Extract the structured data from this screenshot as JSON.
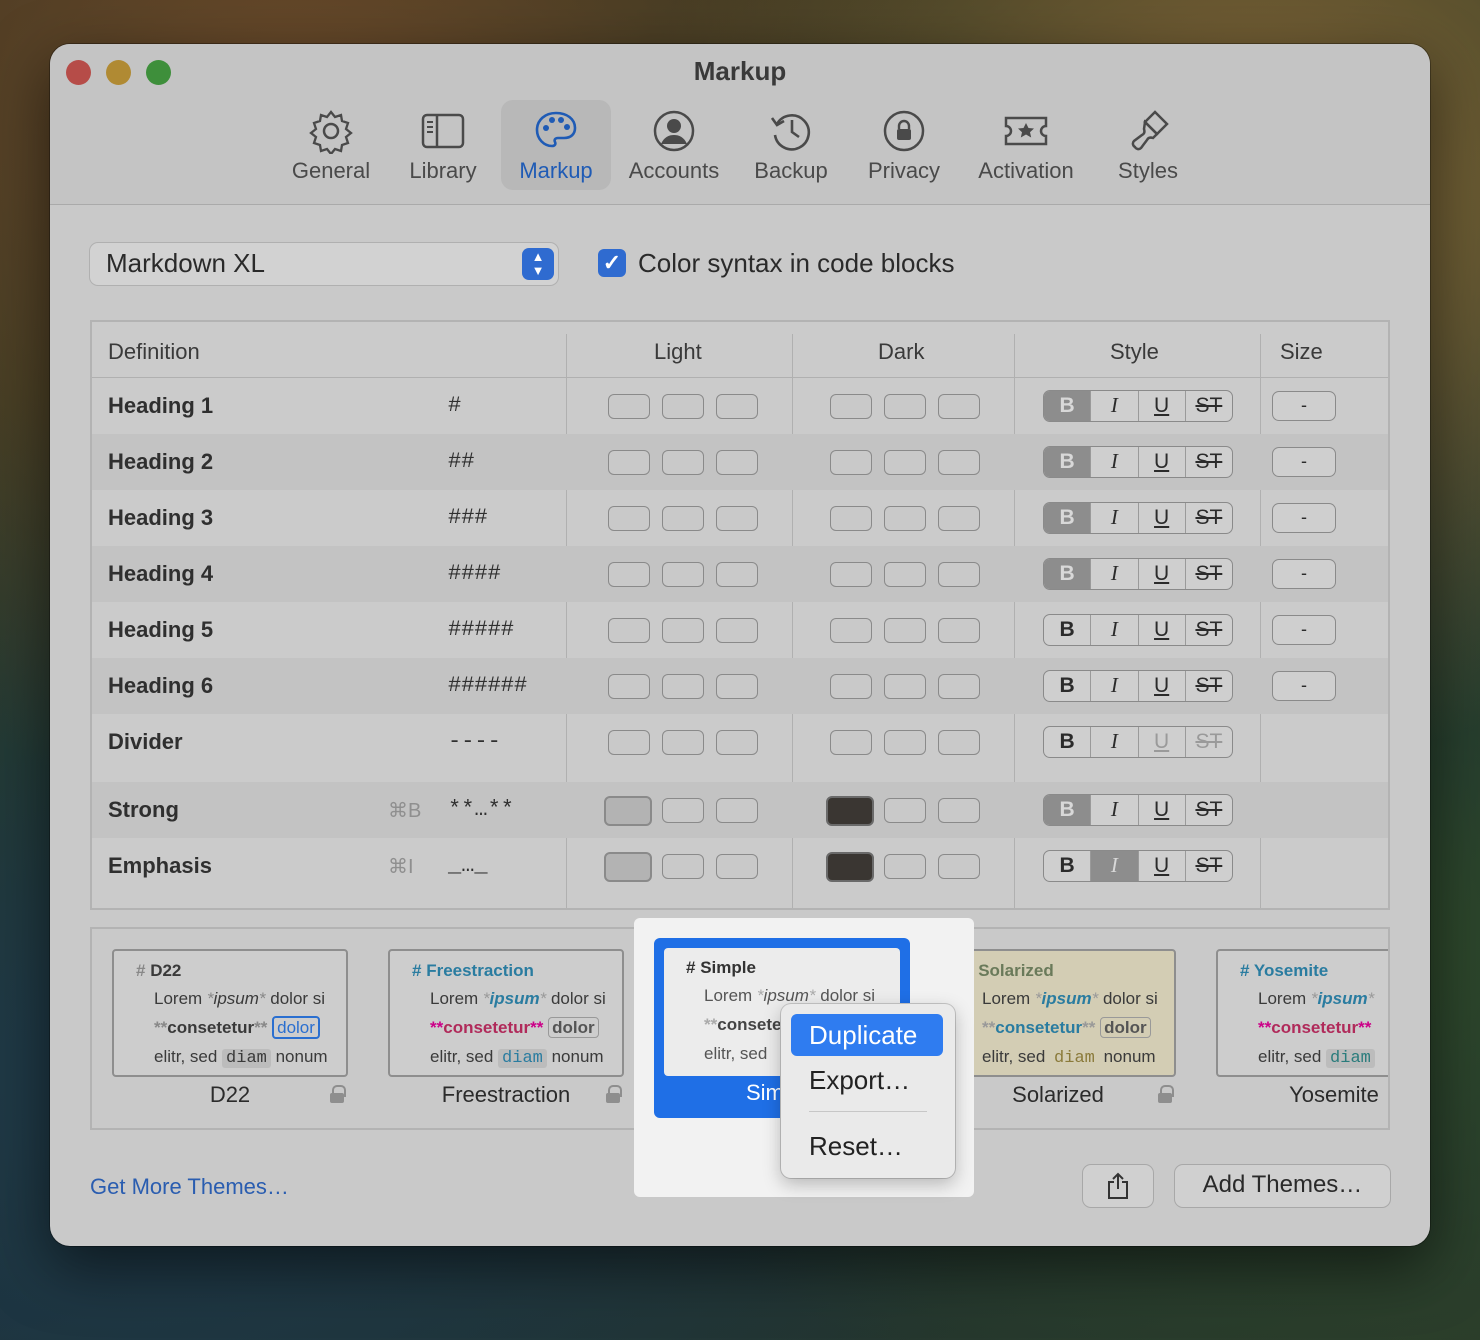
{
  "window": {
    "title": "Markup"
  },
  "toolbar": {
    "tabs": [
      {
        "label": "General",
        "icon": "gear-icon"
      },
      {
        "label": "Library",
        "icon": "sidebar-icon"
      },
      {
        "label": "Markup",
        "icon": "palette-icon",
        "selected": true
      },
      {
        "label": "Accounts",
        "icon": "person-circle-icon"
      },
      {
        "label": "Backup",
        "icon": "clock-arrow-icon"
      },
      {
        "label": "Privacy",
        "icon": "lock-circle-icon"
      },
      {
        "label": "Activation",
        "icon": "ticket-star-icon"
      },
      {
        "label": "Styles",
        "icon": "paintbrush-icon"
      }
    ]
  },
  "settings": {
    "flavor": "Markdown XL",
    "color_syntax_label": "Color syntax in code blocks",
    "color_syntax_checked": true
  },
  "table": {
    "headers": {
      "definition": "Definition",
      "light": "Light",
      "dark": "Dark",
      "style": "Style",
      "size": "Size"
    },
    "style_buttons": [
      "B",
      "I",
      "U",
      "ST"
    ],
    "size_value": "-",
    "rows": [
      {
        "name": "Heading 1",
        "shortcut": "",
        "syntax": "#",
        "bold_on": true
      },
      {
        "name": "Heading 2",
        "shortcut": "",
        "syntax": "##",
        "bold_on": true
      },
      {
        "name": "Heading 3",
        "shortcut": "",
        "syntax": "###",
        "bold_on": true
      },
      {
        "name": "Heading 4",
        "shortcut": "",
        "syntax": "####",
        "bold_on": true
      },
      {
        "name": "Heading 5",
        "shortcut": "",
        "syntax": "#####",
        "bold_on": false
      },
      {
        "name": "Heading 6",
        "shortcut": "",
        "syntax": "######",
        "bold_on": false
      },
      {
        "name": "Divider",
        "shortcut": "",
        "syntax": "----",
        "bold_on": false
      },
      {
        "name": "Strong",
        "shortcut": "⌘B",
        "syntax": "**…**",
        "bold_on": true
      },
      {
        "name": "Emphasis",
        "shortcut": "⌘I",
        "syntax": "_…_",
        "italic_on": true
      }
    ]
  },
  "themes": {
    "sample": {
      "lorem": "Lorem",
      "ipsum": "ipsum",
      "dolor": "dolor si",
      "consetetur": "consetetur",
      "dolore": "dolor",
      "elitr": "elitr, sed",
      "diam": "diam",
      "nonum": "nonum"
    },
    "items": [
      {
        "name": "D22",
        "title": "D22",
        "locked": true
      },
      {
        "name": "Freestraction",
        "title": "Freestraction",
        "locked": true
      },
      {
        "name": "Simple",
        "title": "Simple",
        "label_visible": "Sim",
        "selected": true
      },
      {
        "name": "Solarized",
        "title": "Solarized",
        "locked": true
      },
      {
        "name": "Yosemite",
        "title": "Yosemite",
        "locked": false
      }
    ]
  },
  "context_menu": {
    "items": [
      "Duplicate",
      "Export…",
      "Reset…"
    ],
    "highlighted": "Duplicate"
  },
  "footer": {
    "get_more": "Get More Themes…",
    "add_themes": "Add Themes…"
  },
  "colors": {
    "accent": "#2f7cf0",
    "link": "#2a5db0",
    "crimson": "#b02a5a",
    "teal": "#2a7ca0"
  }
}
